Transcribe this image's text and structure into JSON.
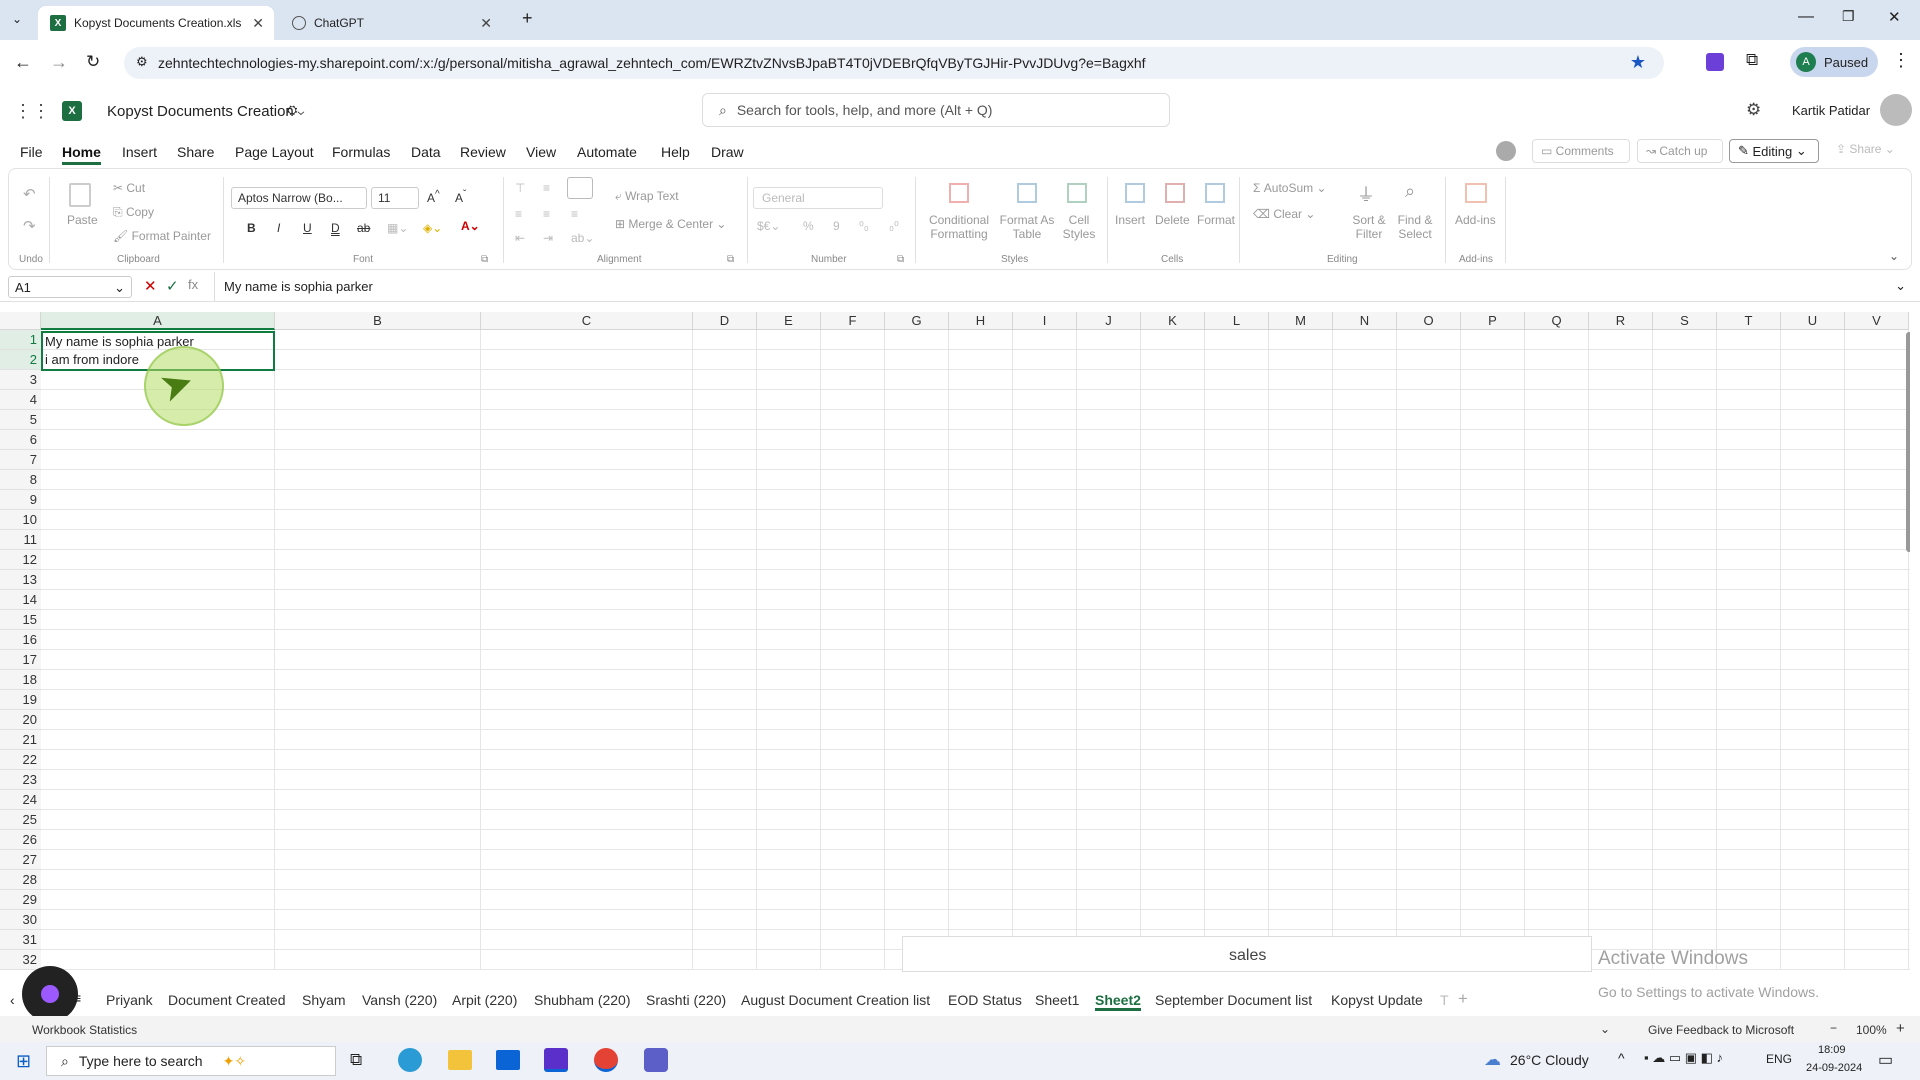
{
  "browser": {
    "tabs": [
      {
        "title": "Kopyst Documents Creation.xls"
      },
      {
        "title": "ChatGPT"
      }
    ],
    "url": "zehntechtechnologies-my.sharepoint.com/:x:/g/personal/mitisha_agrawal_zehntech_com/EWRZtvZNvsBJpaBT4T0jVDEBrQfqVByTGJHir-PvvJDUvg?e=Bagxhf",
    "profile_label": "Paused",
    "profile_initial": "A"
  },
  "app": {
    "doc_title": "Kopyst Documents Creation",
    "search_placeholder": "Search for tools, help, and more (Alt + Q)",
    "user_name": "Kartik Patidar"
  },
  "menu": {
    "items": [
      "File",
      "Home",
      "Insert",
      "Share",
      "Page Layout",
      "Formulas",
      "Data",
      "Review",
      "View",
      "Automate",
      "Help",
      "Draw"
    ],
    "active": "Home",
    "comments": "Comments",
    "catch_up": "Catch up",
    "editing": "Editing",
    "share": "Share"
  },
  "ribbon": {
    "undo_group": "Undo",
    "paste": "Paste",
    "cut": "Cut",
    "copy": "Copy",
    "format_painter": "Format Painter",
    "clipboard": "Clipboard",
    "font_name": "Aptos Narrow (Bo...",
    "font_size": "11",
    "font_group": "Font",
    "wrap_text": "Wrap Text",
    "merge_center": "Merge & Center",
    "alignment": "Alignment",
    "number_format": "General",
    "number_group": "Number",
    "conditional_formatting": "Conditional Formatting",
    "format_as_table": "Format As Table",
    "cell_styles": "Cell Styles",
    "styles_group": "Styles",
    "insert": "Insert",
    "delete": "Delete",
    "format": "Format",
    "cells_group": "Cells",
    "autosum": "AutoSum",
    "clear": "Clear",
    "sort_filter": "Sort & Filter",
    "find_select": "Find & Select",
    "editing_group": "Editing",
    "addins": "Add-ins",
    "addins_group": "Add-ins"
  },
  "formula_bar": {
    "name_box": "A1",
    "formula": "My name is sophia parker"
  },
  "grid": {
    "columns": [
      "A",
      "B",
      "C",
      "D",
      "E",
      "F",
      "G",
      "H",
      "I",
      "J",
      "K",
      "L",
      "M",
      "N",
      "O",
      "P",
      "Q",
      "R",
      "S",
      "T",
      "U",
      "V"
    ],
    "rows": [
      "1",
      "2",
      "3",
      "4",
      "5",
      "6",
      "7",
      "8",
      "9",
      "10",
      "11",
      "12",
      "13",
      "14",
      "15",
      "16",
      "17",
      "18",
      "19",
      "20",
      "21",
      "22",
      "23",
      "24",
      "25",
      "26",
      "27",
      "28",
      "29",
      "30",
      "31",
      "32"
    ],
    "cell_a1": "My name is sophia parker",
    "cell_a2": "i am from indore",
    "chart_title_fragment": "sales",
    "watermark_title": "Activate Windows",
    "watermark_sub": "Go to Settings to activate Windows."
  },
  "sheets": {
    "tabs": [
      "Priyank",
      "Document Created",
      "Shyam",
      "Vansh (220)",
      "Arpit (220)",
      "Shubham (220)",
      "Srashti (220)",
      "August Document Creation list",
      "EOD Status",
      "Sheet1",
      "Sheet2",
      "September Document list",
      "Kopyst Update",
      "T"
    ],
    "active": "Sheet2"
  },
  "status": {
    "left": "Workbook Statistics",
    "feedback": "Give Feedback to Microsoft",
    "zoom": "100%"
  },
  "taskbar": {
    "search_placeholder": "Type here to search",
    "weather": "26°C  Cloudy",
    "lang": "ENG",
    "time": "18:09",
    "date": "24-09-2024"
  }
}
